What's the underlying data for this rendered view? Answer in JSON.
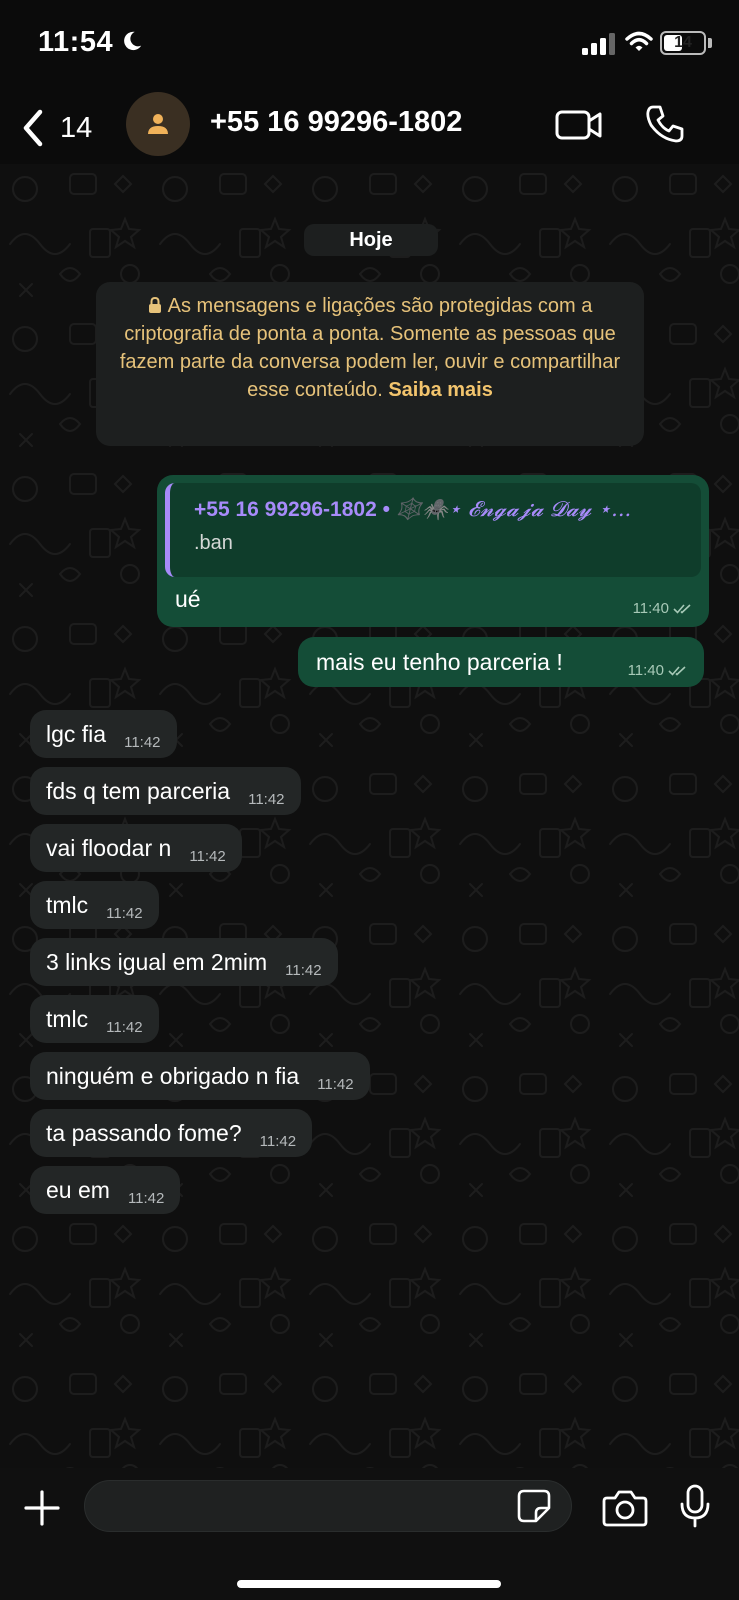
{
  "status_bar": {
    "time": "11:54",
    "battery": "14"
  },
  "header": {
    "back_count": "14",
    "contact": "+55 16 99296-1802"
  },
  "chat": {
    "date_divider": "Hoje",
    "e2e_notice": "As mensagens e ligações são protegidas com a criptografia de ponta a ponta. Somente as pessoas que fazem parte da conversa podem ler, ouvir e compartilhar esse conteúdo.",
    "e2e_learn_more": "Saiba mais",
    "outgoing": [
      {
        "quote_sender": "+55 16 99296-1802",
        "quote_group": "🕸️🕷️⋆ 𝓔𝓷𝓰𝓪𝓳𝓪 𝓓𝓪𝔂 ⋆...",
        "quote_text": ".ban",
        "text": "ué",
        "time": "11:40"
      },
      {
        "text": "mais eu tenho parceria !",
        "time": "11:40"
      }
    ],
    "incoming": [
      {
        "text": "lgc fia",
        "time": "11:42"
      },
      {
        "text": "fds q tem parceria",
        "time": "11:42"
      },
      {
        "text": "vai floodar n",
        "time": "11:42"
      },
      {
        "text": "tmlc",
        "time": "11:42"
      },
      {
        "text": "3 links igual em 2mim",
        "time": "11:42"
      },
      {
        "text": "tmlc",
        "time": "11:42"
      },
      {
        "text": "ninguém e obrigado n fia",
        "time": "11:42"
      },
      {
        "text": "ta passando fome?",
        "time": "11:42"
      },
      {
        "text": "eu em",
        "time": "11:42"
      }
    ]
  },
  "composer": {
    "placeholder": ""
  },
  "colors": {
    "outgoing_bubble": "#144d37",
    "incoming_bubble": "#232626",
    "notice_text": "#e6c27a",
    "quote_accent": "#a78bfa"
  },
  "icons": [
    "moon-icon",
    "signal-icon",
    "wifi-icon",
    "battery-icon",
    "back-chevron-icon",
    "person-icon",
    "video-icon",
    "phone-icon",
    "lock-icon",
    "double-check-icon",
    "plus-icon",
    "sticker-icon",
    "camera-icon",
    "mic-icon"
  ]
}
